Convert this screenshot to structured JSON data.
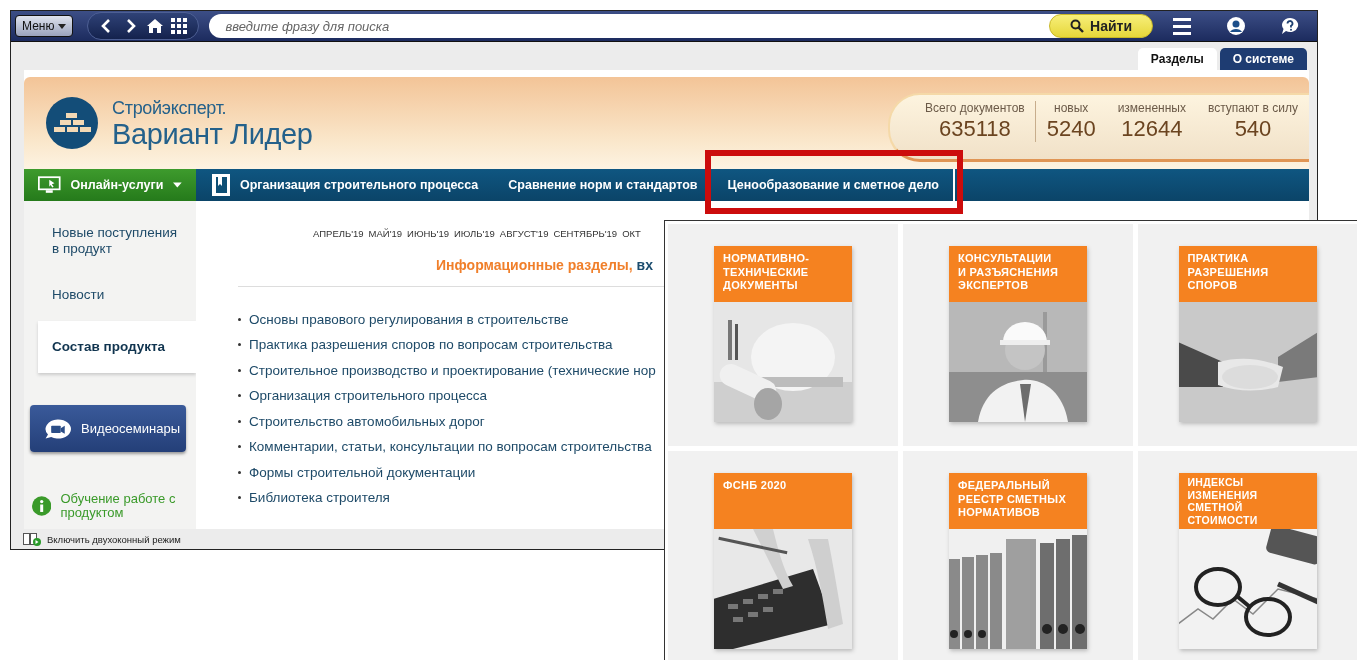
{
  "toolbar": {
    "menu_button": "Меню",
    "search": {
      "placeholder": "введите фразу для поиска"
    },
    "find_button": "Найти"
  },
  "tabs": [
    {
      "label": "Разделы",
      "selected": true
    },
    {
      "label": "О системе",
      "selected": false
    }
  ],
  "header": {
    "brand_top": "Стройэксперт.",
    "brand_main": "Вариант Лидер",
    "stats": [
      {
        "label": "Всего документов",
        "value": "635118"
      },
      {
        "label": "новых",
        "value": "5240"
      },
      {
        "label": "измененных",
        "value": "12644"
      },
      {
        "label": "вступают в силу",
        "value": "540"
      }
    ]
  },
  "nav": [
    {
      "kind": "online",
      "label": "Онлайн-услуги",
      "highlighted": false
    },
    {
      "kind": "book",
      "label": "Организация строительного процесса",
      "highlighted": false
    },
    {
      "kind": "plain",
      "label": "Сравнение норм и стандартов",
      "highlighted": false
    },
    {
      "kind": "plain",
      "label": "Ценообразование и сметное дело",
      "highlighted": true
    }
  ],
  "sidebar": {
    "items": [
      {
        "label": "Новые поступления в продукт",
        "selected": false
      },
      {
        "label": "Новости",
        "selected": false
      },
      {
        "label": "Состав продукта",
        "selected": true
      }
    ],
    "video_button": "Видеосеминары",
    "help_link": "Обучение работе с продуктом"
  },
  "main": {
    "months": [
      "АПРЕЛЬ'19",
      "МАЙ'19",
      "ИЮНЬ'19",
      "ИЮЛЬ'19",
      "АВГУСТ'19",
      "СЕНТЯБРЬ'19",
      "ОКТ"
    ],
    "title": {
      "lead": "Информационные разделы,",
      "rest": "вх"
    },
    "links": [
      "Основы правового регулирования в строительстве",
      "Практика разрешения споров по вопросам строительства",
      "Строительное производство и проектирование (технические нор",
      "Организация строительного процесса",
      "Строительство автомобильных дорог",
      "Комментарии, статьи, консультации по вопросам строительства",
      "Формы строительной документации",
      "Библиотека строителя"
    ]
  },
  "status_bar": "Включить двухоконный режим",
  "overlay": {
    "cards": [
      {
        "title": "НОРМАТИВНО-\nТЕХНИЧЕСКИЕ\nДОКУМЕНТЫ"
      },
      {
        "title": "КОНСУЛЬТАЦИИ\nИ РАЗЪЯСНЕНИЯ\nЭКСПЕРТОВ"
      },
      {
        "title": "ПРАКТИКА\nРАЗРЕШЕНИЯ\nСПОРОВ"
      },
      {
        "title": "ФСНБ 2020"
      },
      {
        "title": "ФЕДЕРАЛЬНЫЙ\nРЕЕСТР СМЕТНЫХ\nНОРМАТИВОВ"
      },
      {
        "title": "ИНДЕКСЫ\nИЗМЕНЕНИЯ\nСМЕТНОЙ\nСТОИМОСТИ"
      }
    ]
  }
}
